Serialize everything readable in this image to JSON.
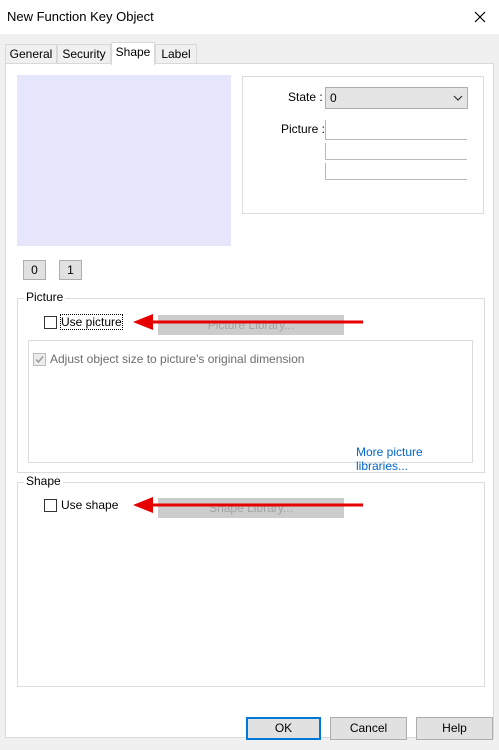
{
  "window": {
    "title": "New Function Key Object",
    "close_icon": "close-icon"
  },
  "tabs": [
    {
      "label": "General",
      "active": false
    },
    {
      "label": "Security",
      "active": false
    },
    {
      "label": "Shape",
      "active": true
    },
    {
      "label": "Label",
      "active": false
    }
  ],
  "state_panel": {
    "state_label": "State :",
    "state_value": "0",
    "picture_label": "Picture :"
  },
  "state_buttons": [
    "0",
    "1"
  ],
  "picture_group": {
    "title": "Picture",
    "use_picture_label": "Use picture",
    "use_picture_checked": false,
    "library_button": "Picture Library...",
    "adjust_label": "Adjust object size to picture's original dimension",
    "adjust_checked": true,
    "more_link": "More picture libraries..."
  },
  "shape_group": {
    "title": "Shape",
    "use_shape_label": "Use shape",
    "use_shape_checked": false,
    "library_button": "Shape Library..."
  },
  "footer": {
    "ok": "OK",
    "cancel": "Cancel",
    "help": "Help"
  },
  "colors": {
    "preview_fill": "#e5e6fb",
    "arrow": "#e60000",
    "link": "#0066cc",
    "default_button_border": "#0078d7"
  }
}
